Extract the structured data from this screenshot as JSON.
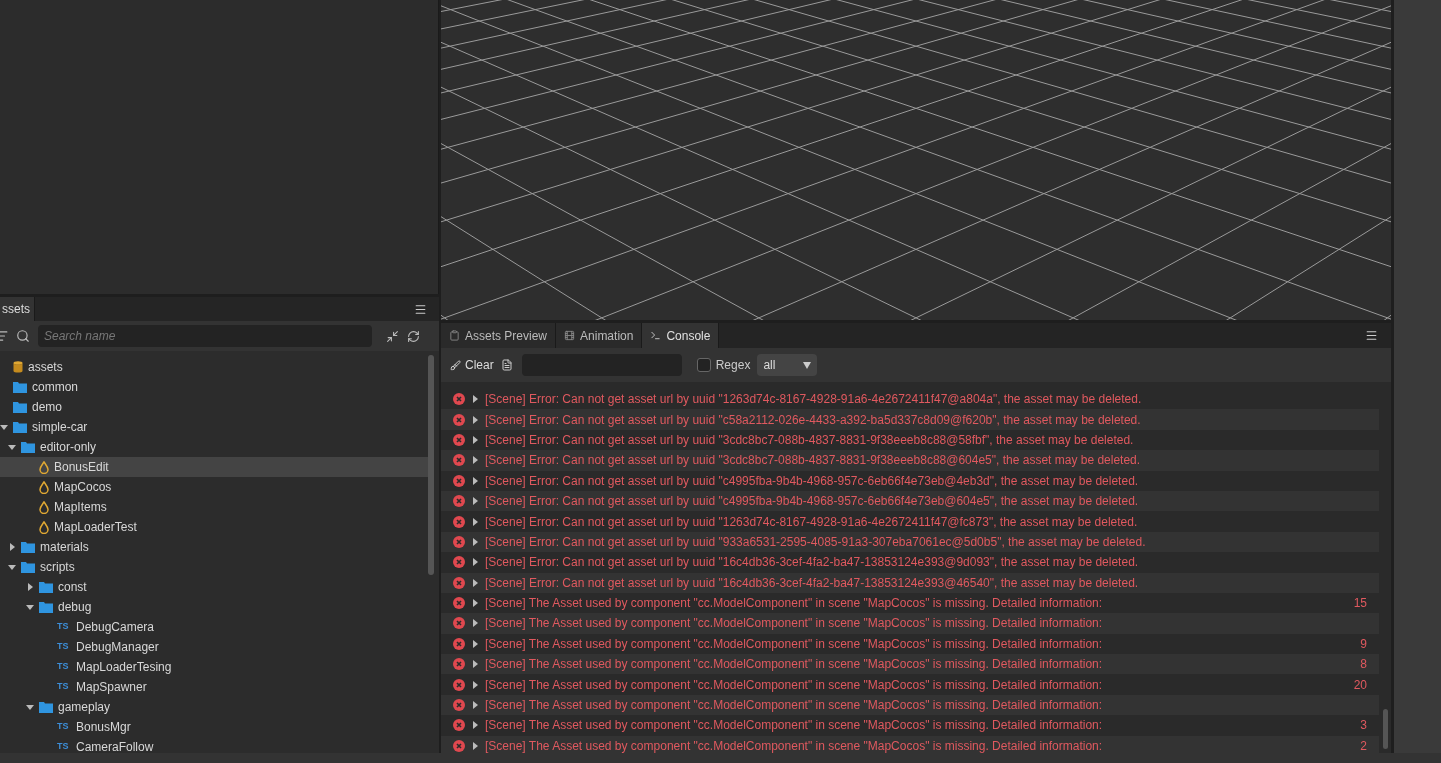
{
  "assets_panel": {
    "tab": "ssets",
    "search": {
      "placeholder": "Search name"
    },
    "tree": [
      {
        "label": "assets",
        "kind": "db",
        "selected": false,
        "children": [
          {
            "label": "common",
            "kind": "folder",
            "selected": false
          },
          {
            "label": "demo",
            "kind": "folder",
            "selected": false
          },
          {
            "label": "simple-car",
            "kind": "folder",
            "expanded": true,
            "selected": false,
            "children": [
              {
                "label": "editor-only",
                "kind": "folder",
                "expanded": true,
                "selected": false,
                "children": [
                  {
                    "label": "BonusEdit",
                    "kind": "scene",
                    "selected": true
                  },
                  {
                    "label": "MapCocos",
                    "kind": "scene",
                    "selected": false
                  },
                  {
                    "label": "MapItems",
                    "kind": "scene",
                    "selected": false
                  },
                  {
                    "label": "MapLoaderTest",
                    "kind": "scene",
                    "selected": false
                  }
                ]
              },
              {
                "label": "materials",
                "kind": "folder",
                "expanded": false,
                "selected": false
              },
              {
                "label": "scripts",
                "kind": "folder",
                "expanded": true,
                "selected": false,
                "children": [
                  {
                    "label": "const",
                    "kind": "folder",
                    "expanded": false,
                    "selected": false
                  },
                  {
                    "label": "debug",
                    "kind": "folder",
                    "expanded": true,
                    "selected": false,
                    "children": [
                      {
                        "label": "DebugCamera",
                        "kind": "ts",
                        "badge": "TS",
                        "selected": false
                      },
                      {
                        "label": "DebugManager",
                        "kind": "ts",
                        "badge": "TS",
                        "selected": false
                      },
                      {
                        "label": "MapLoaderTesing",
                        "kind": "ts",
                        "badge": "TS",
                        "selected": false
                      },
                      {
                        "label": "MapSpawner",
                        "kind": "ts",
                        "badge": "TS",
                        "selected": false
                      }
                    ]
                  },
                  {
                    "label": "gameplay",
                    "kind": "folder",
                    "expanded": true,
                    "selected": false,
                    "children": [
                      {
                        "label": "BonusMgr",
                        "kind": "ts",
                        "badge": "TS",
                        "selected": false
                      },
                      {
                        "label": "CameraFollow",
                        "kind": "ts",
                        "badge": "TS",
                        "selected": false
                      }
                    ]
                  }
                ]
              }
            ]
          }
        ]
      }
    ]
  },
  "console_panel": {
    "tabs": [
      {
        "label": "Assets Preview",
        "kind": "preview",
        "selected": false
      },
      {
        "label": "Animation",
        "kind": "animation",
        "selected": false
      },
      {
        "label": "Console",
        "kind": "console",
        "selected": true
      }
    ],
    "clear_button": "Clear",
    "regex": {
      "label": "Regex",
      "checked": false
    },
    "level_select": "all",
    "logs": [
      {
        "text": "[Scene] Error: Can not get asset url by uuid \"1263d74c-8167-4928-91a6-4e2672411f47@a804a\", the asset may be deleted."
      },
      {
        "text": "[Scene] Error: Can not get asset url by uuid \"c58a2112-026e-4433-a392-ba5d337c8d09@f620b\", the asset may be deleted."
      },
      {
        "text": "[Scene] Error: Can not get asset url by uuid \"3cdc8bc7-088b-4837-8831-9f38eeeb8c88@58fbf\", the asset may be deleted."
      },
      {
        "text": "[Scene] Error: Can not get asset url by uuid \"3cdc8bc7-088b-4837-8831-9f38eeeb8c88@604e5\", the asset may be deleted."
      },
      {
        "text": "[Scene] Error: Can not get asset url by uuid \"c4995fba-9b4b-4968-957c-6eb66f4e73eb@4eb3d\", the asset may be deleted."
      },
      {
        "text": "[Scene] Error: Can not get asset url by uuid \"c4995fba-9b4b-4968-957c-6eb66f4e73eb@604e5\", the asset may be deleted."
      },
      {
        "text": "[Scene] Error: Can not get asset url by uuid \"1263d74c-8167-4928-91a6-4e2672411f47@fc873\", the asset may be deleted."
      },
      {
        "text": "[Scene] Error: Can not get asset url by uuid \"933a6531-2595-4085-91a3-307eba7061ec@5d0b5\", the asset may be deleted."
      },
      {
        "text": "[Scene] Error: Can not get asset url by uuid \"16c4db36-3cef-4fa2-ba47-13853124e393@9d093\", the asset may be deleted."
      },
      {
        "text": "[Scene] Error: Can not get asset url by uuid \"16c4db36-3cef-4fa2-ba47-13853124e393@46540\", the asset may be deleted."
      },
      {
        "text": "[Scene] The Asset used by component \"cc.ModelComponent\" in scene \"MapCocos\" is missing. Detailed information:",
        "count": "15"
      },
      {
        "text": "[Scene] The Asset used by component \"cc.ModelComponent\" in scene \"MapCocos\" is missing. Detailed information:"
      },
      {
        "text": "[Scene] The Asset used by component \"cc.ModelComponent\" in scene \"MapCocos\" is missing. Detailed information:",
        "count": "9"
      },
      {
        "text": "[Scene] The Asset used by component \"cc.ModelComponent\" in scene \"MapCocos\" is missing. Detailed information:",
        "count": "8"
      },
      {
        "text": "[Scene] The Asset used by component \"cc.ModelComponent\" in scene \"MapCocos\" is missing. Detailed information:",
        "count": "20"
      },
      {
        "text": "[Scene] The Asset used by component \"cc.ModelComponent\" in scene \"MapCocos\" is missing. Detailed information:"
      },
      {
        "text": "[Scene] The Asset used by component \"cc.ModelComponent\" in scene \"MapCocos\" is missing. Detailed information:",
        "count": "3"
      },
      {
        "text": "[Scene] The Asset used by component \"cc.ModelComponent\" in scene \"MapCocos\" is missing. Detailed information:",
        "count": "2"
      }
    ]
  }
}
